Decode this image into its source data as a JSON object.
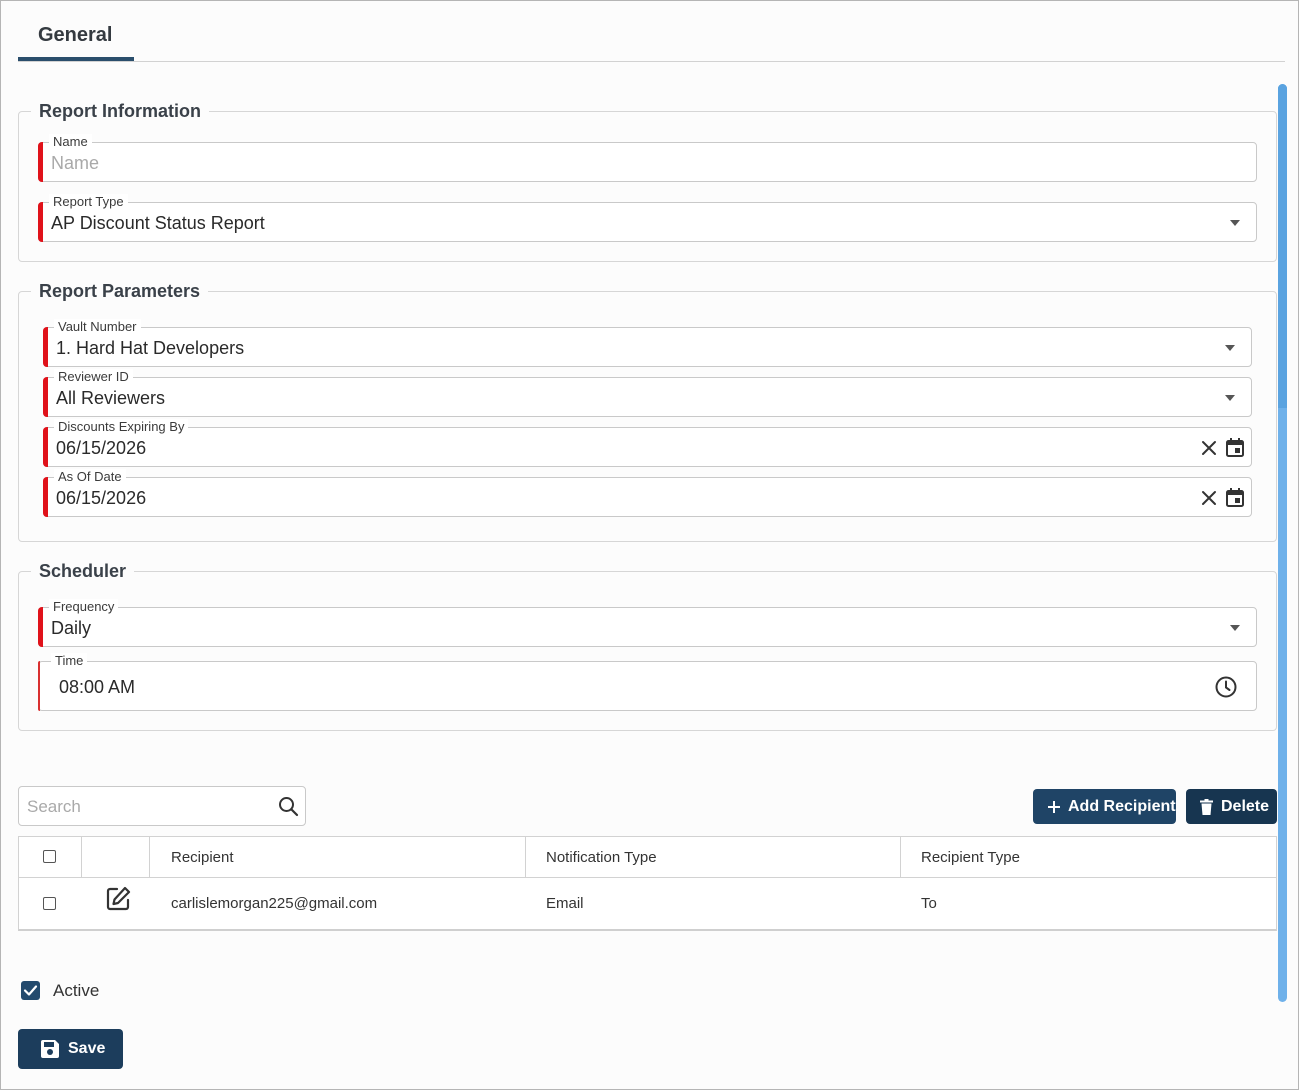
{
  "tabs": [
    {
      "label": "General"
    }
  ],
  "report_info": {
    "legend": "Report Information",
    "name": {
      "label": "Name",
      "placeholder": "Name",
      "value": ""
    },
    "report_type": {
      "label": "Report Type",
      "value": "AP Discount Status Report"
    }
  },
  "report_params": {
    "legend": "Report Parameters",
    "vault_number": {
      "label": "Vault Number",
      "value": "1. Hard Hat Developers"
    },
    "reviewer_id": {
      "label": "Reviewer ID",
      "value": "All Reviewers"
    },
    "discounts_expiring_by": {
      "label": "Discounts Expiring By",
      "value": "06/15/2026"
    },
    "as_of_date": {
      "label": "As Of Date",
      "value": "06/15/2026"
    }
  },
  "scheduler": {
    "legend": "Scheduler",
    "frequency": {
      "label": "Frequency",
      "value": "Daily"
    },
    "time": {
      "label": "Time",
      "value": "08:00 AM"
    }
  },
  "recipients": {
    "search_placeholder": "Search",
    "add_label": "Add Recipient",
    "delete_label": "Delete",
    "columns": [
      "Recipient",
      "Notification Type",
      "Recipient Type"
    ],
    "rows": [
      {
        "recipient": "carlislemorgan225@gmail.com",
        "notification_type": "Email",
        "recipient_type": "To",
        "selected": false
      }
    ]
  },
  "active": {
    "label": "Active",
    "checked": true
  },
  "save_label": "Save",
  "colors": {
    "primary": "#1f4466",
    "required": "#e0121a",
    "scroll_thumb": "#6fb1ea"
  },
  "icons": [
    "chevron-down-icon",
    "clear-icon",
    "calendar-icon",
    "clock-icon",
    "search-icon",
    "plus-icon",
    "trash-icon",
    "edit-icon",
    "save-icon",
    "check-icon"
  ]
}
